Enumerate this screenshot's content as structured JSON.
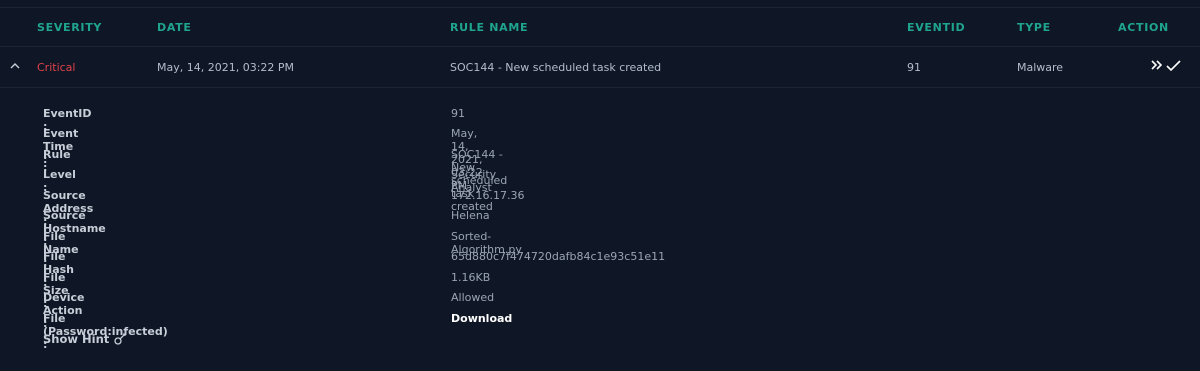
{
  "table": {
    "headers": {
      "severity": "SEVERITY",
      "date": "DATE",
      "rule_name": "RULE NAME",
      "eventid": "EVENTID",
      "type": "TYPE",
      "action": "ACTION"
    },
    "row": {
      "severity": "Critical",
      "date": "May, 14, 2021, 03:22 PM",
      "rule_name": "SOC144 - New scheduled task created",
      "eventid": "91",
      "type": "Malware"
    }
  },
  "details": {
    "event_id": {
      "label": "EventID :",
      "value": "91"
    },
    "event_time": {
      "label": "Event Time :",
      "value": "May, 14, 2021, 03:22 PM"
    },
    "rule": {
      "label": "Rule :",
      "value": "SOC144 - New scheduled task created"
    },
    "level": {
      "label": "Level :",
      "value": "Security Analyst"
    },
    "source_address": {
      "label": "Source Address :",
      "value": "172.16.17.36"
    },
    "source_hostname": {
      "label": "Source Hostname :",
      "value": "Helena"
    },
    "file_name": {
      "label": "File Name :",
      "value": "Sorted-Algorithm.py"
    },
    "file_hash": {
      "label": "File Hash :",
      "value": "65d880c7f474720dafb84c1e93c51e11"
    },
    "file_size": {
      "label": "File Size :",
      "value": "1.16KB"
    },
    "device_action": {
      "label": "Device Action :",
      "value": "Allowed"
    },
    "file_download": {
      "label": "File (Password:infected) :",
      "value": "Download"
    }
  },
  "hint": {
    "label": "Show Hint",
    "icon": "key-icon"
  },
  "icons": {
    "collapse": "chevron-up-icon",
    "escalate": "double-chevron-right-icon",
    "close": "check-icon"
  },
  "colors": {
    "accent": "#1fa58f",
    "critical": "#e0404a",
    "background": "#0f1726"
  }
}
